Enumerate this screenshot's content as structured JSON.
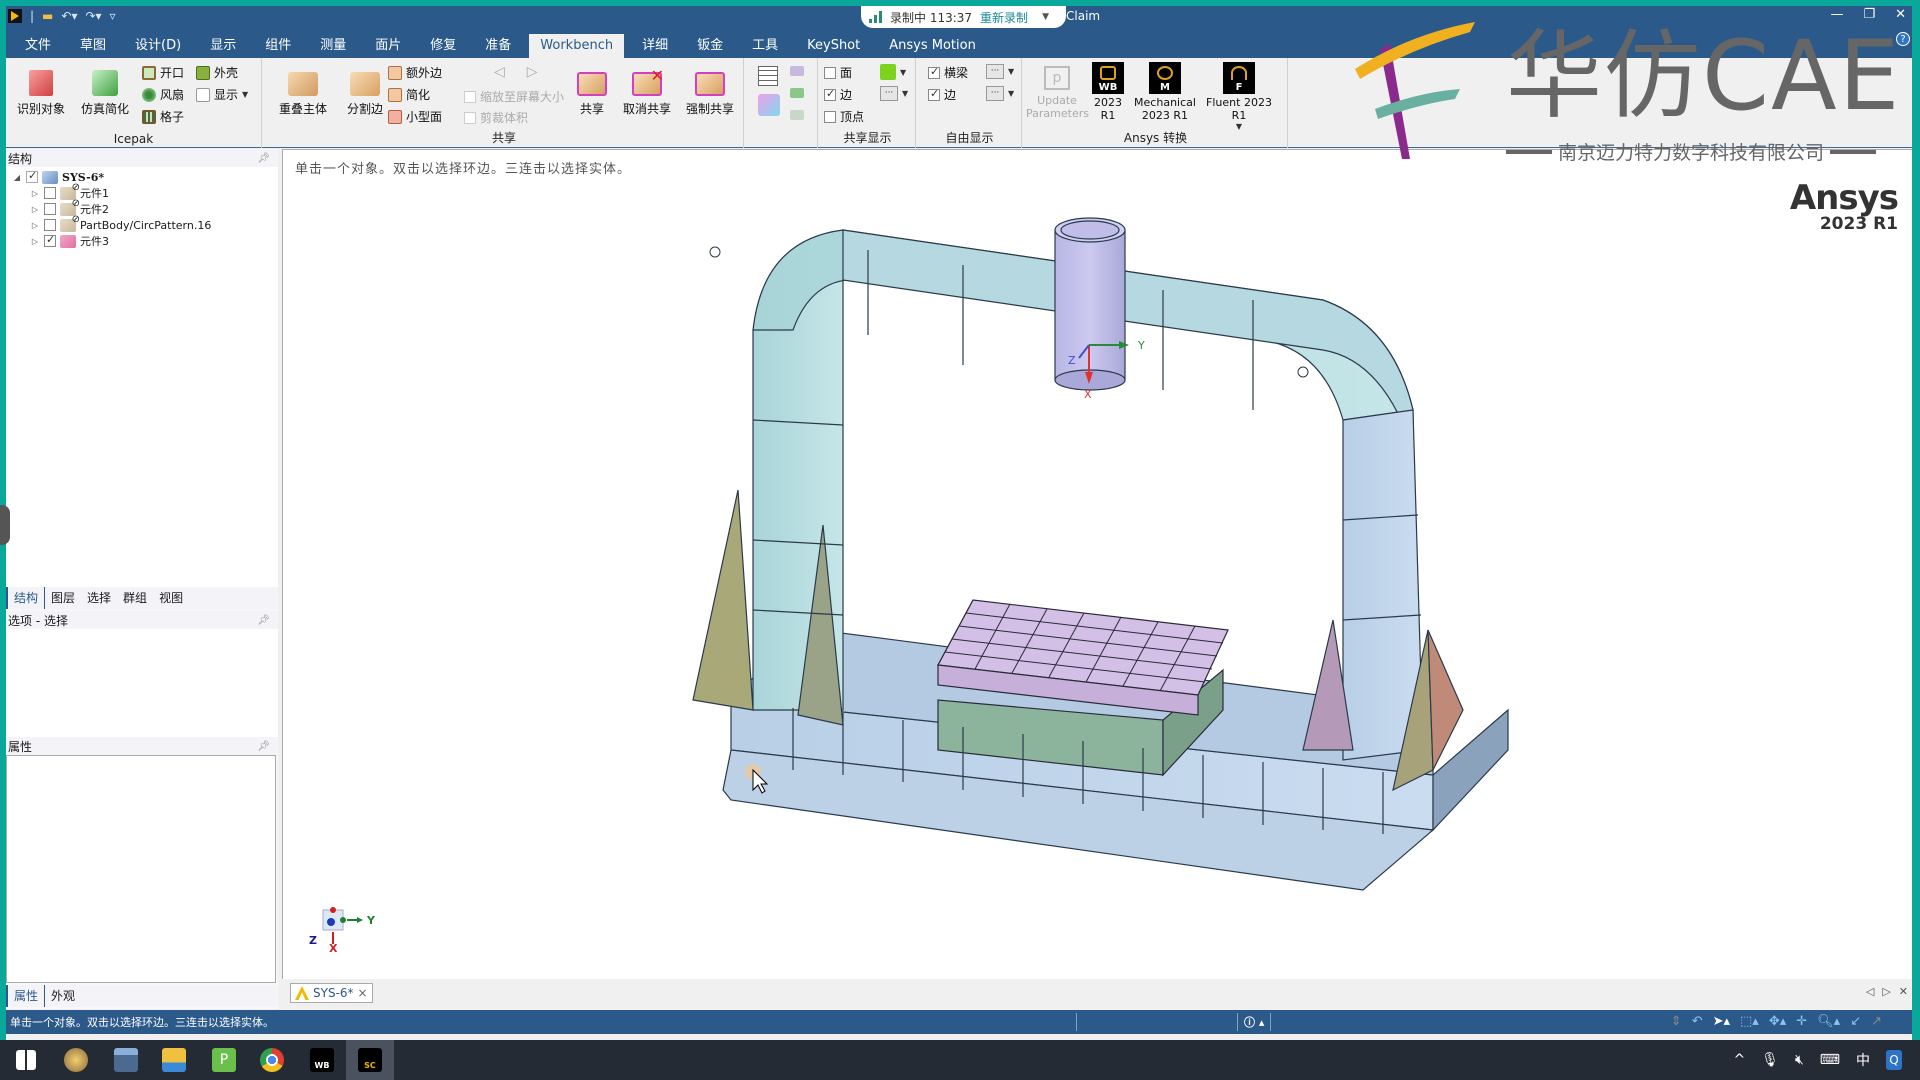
{
  "window": {
    "title": "Claim",
    "controls": {
      "minimize": "—",
      "restore": "❐",
      "close": "✕"
    },
    "help": "?"
  },
  "recording": {
    "status": "录制中 113:37",
    "action": "重新录制"
  },
  "menu": {
    "tabs": [
      "文件",
      "草图",
      "设计(D)",
      "显示",
      "组件",
      "测量",
      "面片",
      "修复",
      "准备",
      "Workbench",
      "详细",
      "钣金",
      "工具",
      "KeyShot",
      "Ansys Motion"
    ],
    "active": "Workbench"
  },
  "ribbon": {
    "icepak": {
      "label": "Icepak",
      "identify": "识别对象",
      "simplify": "仿真简化",
      "opening": "开口",
      "fan": "风扇",
      "grille": "格子",
      "enclosure": "外壳",
      "display": "显示"
    },
    "share": {
      "label": "共享",
      "overlap": "重叠主体",
      "split_edge": "分割边",
      "extra_edge": "额外边",
      "simplify": "简化",
      "small_face": "小型面",
      "zoom_to_fit": "缩放至屏幕大小",
      "clip_volume": "剪裁体积",
      "share": "共享",
      "unshare": "取消共享",
      "force_share": "强制共享"
    },
    "share_display": {
      "label": "共享显示",
      "face": {
        "label": "面",
        "checked": false
      },
      "edge": {
        "label": "边",
        "checked": true
      },
      "vertex": {
        "label": "顶点",
        "checked": false
      },
      "face_color": "#7ed321"
    },
    "free_display": {
      "label": "自由显示",
      "beam": {
        "label": "横梁",
        "checked": true
      },
      "edge": {
        "label": "边",
        "checked": true
      }
    },
    "ansys": {
      "label": "Ansys 转换",
      "update_params": "Update Parameters",
      "wb": {
        "badge": "WB",
        "label": "2023 R1"
      },
      "mechanical": {
        "badge": "M",
        "label": "Mechanical 2023 R1"
      },
      "fluent": {
        "badge": "F",
        "label": "Fluent 2023 R1"
      }
    }
  },
  "watermark": {
    "title": "华仿CAE",
    "subtitle": "南京迈力特力数字科技有限公司"
  },
  "structure": {
    "title": "结构",
    "root": {
      "label": "SYS-6*",
      "checked": true
    },
    "items": [
      {
        "label": "元件1",
        "checked": false
      },
      {
        "label": "元件2",
        "checked": false
      },
      {
        "label": "PartBody/CircPattern.16",
        "checked": false
      },
      {
        "label": "元件3",
        "checked": true
      }
    ]
  },
  "panel_tabs": [
    "结构",
    "图层",
    "选择",
    "群组",
    "视图"
  ],
  "options": {
    "title": "选项 - 选择"
  },
  "properties": {
    "title": "属性"
  },
  "bottom_tabs": [
    "属性",
    "外观"
  ],
  "viewport": {
    "hint": "单击一个对象。双击以选择环边。三连击以选择实体。",
    "brand_name": "Ansys",
    "brand_version": "2023 R1",
    "triad": {
      "x": "X",
      "y": "Y",
      "z": "Z"
    }
  },
  "document_tab": {
    "label": "SYS-6*",
    "close": "×"
  },
  "status": {
    "text": "单击一个对象。双击以选择环边。三连击以选择实体。"
  },
  "taskbar": {
    "apps": [
      "start",
      "paint",
      "calculator",
      "file-explorer",
      "pycharm-edu",
      "chrome",
      "workbench",
      "spaceclaim"
    ],
    "tray": {
      "ime": "中"
    }
  }
}
